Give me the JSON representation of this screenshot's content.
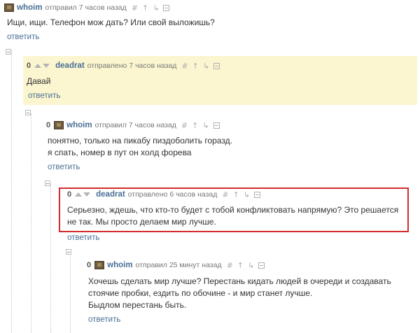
{
  "comments": [
    {
      "author": "whoim",
      "sent": "отправил 7 часов назад",
      "text": [
        "Ищи, ищи. Телефон мож дать? Или свой выложишь?"
      ],
      "reply": "ответить"
    },
    {
      "rating": "0",
      "author": "deadrat",
      "sent": "отправлено 7 часов назад",
      "text": [
        "Давай"
      ],
      "reply": "ответить"
    },
    {
      "rating": "0",
      "author": "whoim",
      "sent": "отправил 7 часов назад",
      "text": [
        "понятно, только на пикабу пиздоболить горазд.",
        "я спать, номер в пут он холд форева"
      ],
      "reply": "ответить"
    },
    {
      "rating": "0",
      "author": "deadrat",
      "sent": "отправлено 6 часов назад",
      "text": [
        "Серьезно, ждешь, что кто-то будет с тобой конфликтовать напрямую? Это решается",
        "не так. Мы просто делаем мир лучше."
      ],
      "reply": "ответить"
    },
    {
      "rating": "0",
      "author": "whoim",
      "sent": "отправил 25 минут назад",
      "text": [
        "Хочешь сделать мир лучше? Перестань кидать людей в очереди и создавать",
        "стоячие пробки, ездить по обочине - и мир станет лучше.",
        "Быдлом перестань быть."
      ],
      "reply": "ответить"
    }
  ],
  "icons": [
    "hash-icon",
    "up-link-icon",
    "thread-link-icon",
    "save-icon"
  ],
  "colors": {
    "author": "#4a6f95",
    "highlight_bg": "#fbf6cf",
    "red_frame": "#d42b2b"
  }
}
